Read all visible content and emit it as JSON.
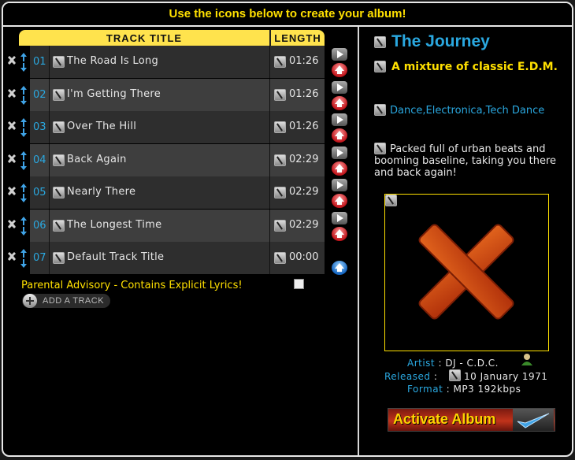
{
  "header": {
    "instruction": "Use the icons below to create your album!"
  },
  "table": {
    "col_title": "TRACK TITLE",
    "col_length": "LENGTH",
    "rows": [
      {
        "num": "01",
        "title": "The Road Is Long",
        "length": "01:26"
      },
      {
        "num": "02",
        "title": "I'm Getting There",
        "length": "01:26"
      },
      {
        "num": "03",
        "title": "Over The Hill",
        "length": "01:26"
      },
      {
        "num": "04",
        "title": "Back Again",
        "length": "02:29"
      },
      {
        "num": "05",
        "title": "Nearly There",
        "length": "02:29"
      },
      {
        "num": "06",
        "title": "The Longest Time",
        "length": "02:29"
      },
      {
        "num": "07",
        "title": "Default Track Title",
        "length": "00:00"
      }
    ]
  },
  "parental": {
    "label": "Parental Advisory - Contains Explicit Lyrics!",
    "checked": false
  },
  "add_track": {
    "label": "ADD A TRACK"
  },
  "album": {
    "title": "The Journey",
    "subtitle": "A mixture of classic E.D.M.",
    "genre": "Dance,Electronica,Tech Dance",
    "description": "Packed full of urban beats and booming baseline, taking you there and back again!",
    "artist_label": "Artist",
    "artist": "DJ - C.D.C.",
    "released_label": "Released",
    "released": "10 January 1971",
    "format_label": "Format",
    "format": "MP3 192kbps",
    "activate_label": "Activate Album"
  },
  "colors": {
    "accent_yellow": "#ffe000",
    "accent_blue": "#2aa8e0",
    "background": "#000000"
  }
}
